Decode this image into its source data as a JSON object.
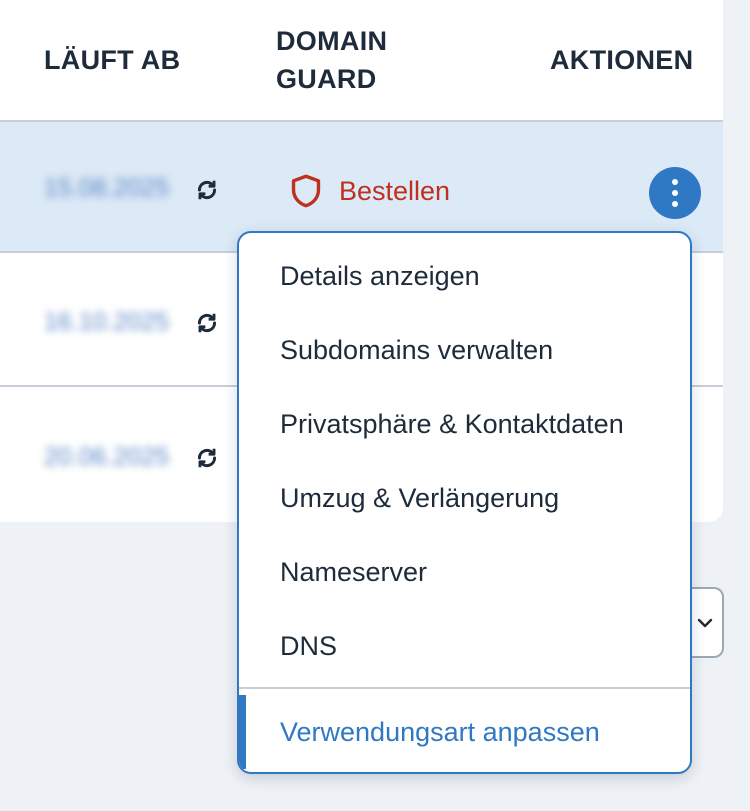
{
  "table": {
    "headers": {
      "expires": "LÄUFT AB",
      "guard_line1": "DOMAIN",
      "guard_line2": "GUARD",
      "actions": "AKTIONEN"
    },
    "rows": [
      {
        "expires": "15.08.2025",
        "guard": "Bestellen"
      },
      {
        "expires": "16.10.2025"
      },
      {
        "expires": "20.06.2025"
      }
    ]
  },
  "action_menu": {
    "items": [
      "Details anzeigen",
      "Subdomains verwalten",
      "Privatsphäre & Kontaktdaten",
      "Umzug & Verlängerung",
      "Nameserver",
      "DNS"
    ],
    "highlighted_item": "Verwendungsart anpassen"
  },
  "colors": {
    "accent": "#2f79c4",
    "guard_red": "#c0301f",
    "selected_row": "#dce9f6"
  },
  "icons": {
    "auto_renew": "refresh-icon",
    "guard": "shield-icon",
    "actions": "more-vertical-icon",
    "pager": "chevron-down-icon"
  }
}
